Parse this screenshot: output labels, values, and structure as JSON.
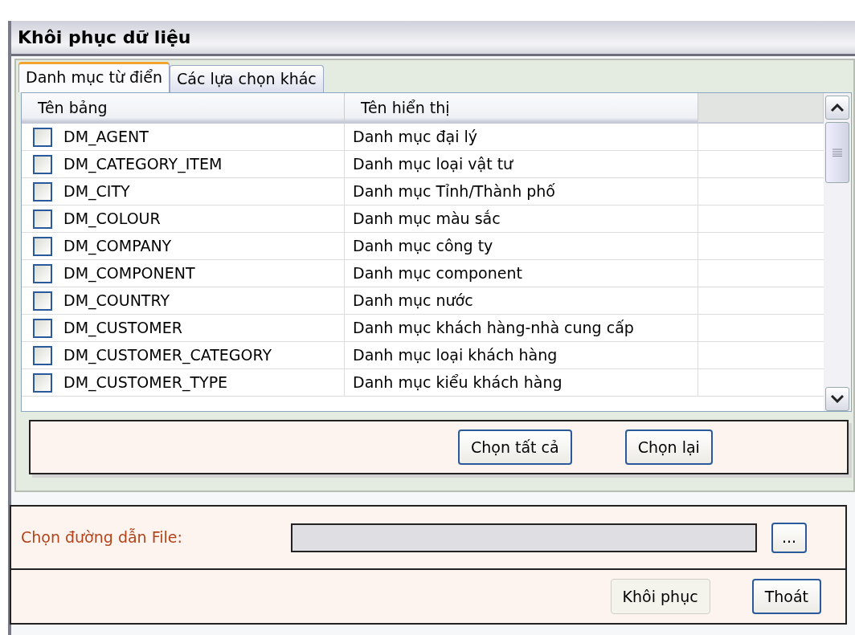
{
  "window": {
    "title": "Khôi phục dữ liệu"
  },
  "tabs": [
    {
      "label": "Danh mục từ điển",
      "selected": true
    },
    {
      "label": "Các lựa chọn khác",
      "selected": false
    }
  ],
  "table": {
    "columns": [
      "Tên bảng",
      "Tên hiển thị"
    ],
    "rows": [
      {
        "checked": false,
        "table_name": "DM_AGENT",
        "display_name": "Danh mục đại lý"
      },
      {
        "checked": false,
        "table_name": "DM_CATEGORY_ITEM",
        "display_name": "Danh mục loại vật tư"
      },
      {
        "checked": false,
        "table_name": "DM_CITY",
        "display_name": "Danh mục Tỉnh/Thành phố"
      },
      {
        "checked": false,
        "table_name": "DM_COLOUR",
        "display_name": "Danh mục màu sắc"
      },
      {
        "checked": false,
        "table_name": "DM_COMPANY",
        "display_name": "Danh mục công ty"
      },
      {
        "checked": false,
        "table_name": "DM_COMPONENT",
        "display_name": "Danh mục component"
      },
      {
        "checked": false,
        "table_name": "DM_COUNTRY",
        "display_name": "Danh mục nước"
      },
      {
        "checked": false,
        "table_name": "DM_CUSTOMER",
        "display_name": "Danh mục khách hàng-nhà cung cấp"
      },
      {
        "checked": false,
        "table_name": "DM_CUSTOMER_CATEGORY",
        "display_name": "Danh mục loại khách hàng"
      },
      {
        "checked": false,
        "table_name": "DM_CUSTOMER_TYPE",
        "display_name": "Danh mục kiểu khách hàng"
      }
    ]
  },
  "selection_buttons": [
    {
      "label": "Chọn tất cả"
    },
    {
      "label": "Chọn lại"
    }
  ],
  "file_path": {
    "label": "Chọn đường dẫn File:",
    "browse_button": "..."
  },
  "action_buttons": [
    {
      "label": "Khôi phục",
      "disabled": true
    },
    {
      "label": "Thoát",
      "disabled": false
    }
  ]
}
